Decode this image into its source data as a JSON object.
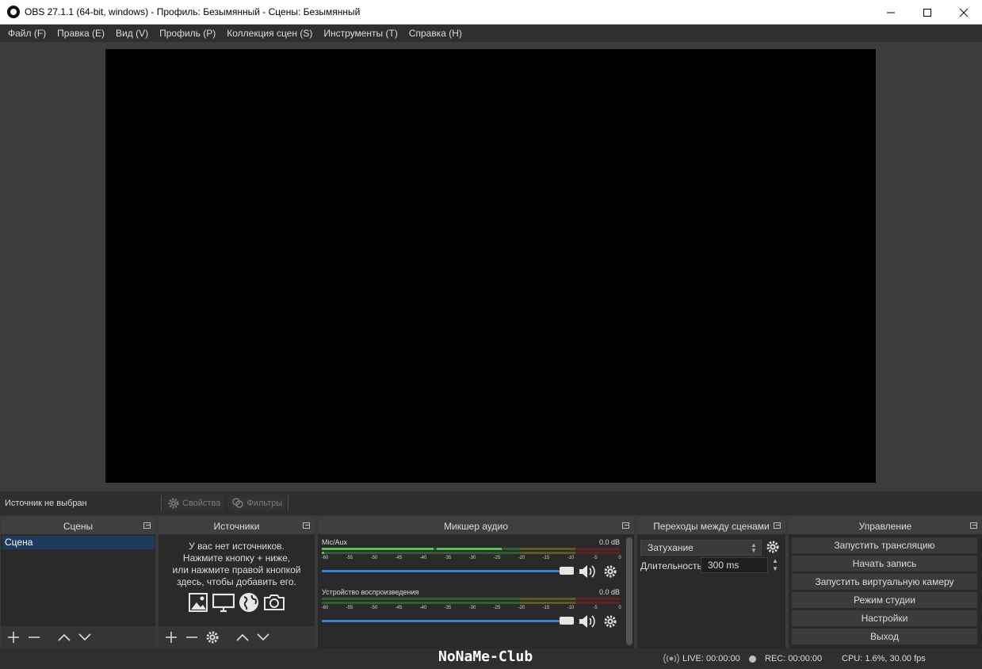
{
  "window": {
    "title": "OBS 27.1.1 (64-bit, windows) - Профиль: Безымянный - Сцены: Безымянный",
    "minimize": "—",
    "maximize": "☐",
    "close": "✕"
  },
  "menu": [
    "Файл (F)",
    "Правка (E)",
    "Вид (V)",
    "Профиль (P)",
    "Коллекция сцен (S)",
    "Инструменты (T)",
    "Справка (H)"
  ],
  "source_bar": {
    "no_source": "Источник не выбран",
    "properties": "Свойства",
    "filters": "Фильтры"
  },
  "docks": {
    "scenes": {
      "title": "Сцены",
      "items": [
        "Сцена"
      ]
    },
    "sources": {
      "title": "Источники",
      "empty_line1": "У вас нет источников.",
      "empty_line2": "Нажмите кнопку + ниже,",
      "empty_line3": "или нажмите правой кнопкой",
      "empty_line4": "здесь, чтобы добавить его."
    },
    "mixer": {
      "title": "Микшер аудио",
      "channels": [
        {
          "name": "Mic/Aux",
          "db": "0.0 dB",
          "volume": 1.0
        },
        {
          "name": "Устройство воспроизведения",
          "db": "0.0 dB",
          "volume": 1.0
        }
      ],
      "ticks": [
        "-60",
        "-55",
        "-50",
        "-45",
        "-40",
        "-35",
        "-30",
        "-25",
        "-20",
        "-15",
        "-10",
        "-5",
        "0"
      ]
    },
    "transitions": {
      "title": "Переходы между сценами",
      "selected": "Затухание",
      "duration_label": "Длительность",
      "duration_value": "300 ms"
    },
    "controls": {
      "title": "Управление",
      "buttons": [
        "Запустить трансляцию",
        "Начать запись",
        "Запустить виртуальную камеру",
        "Режим студии",
        "Настройки",
        "Выход"
      ]
    }
  },
  "status": {
    "watermark": "NoNaMe-Club",
    "live": "LIVE: 00:00:00",
    "rec": "REC: 00:00:00",
    "cpu": "CPU: 1.6%, 30.00 fps"
  },
  "colors": {
    "accent_blue": "#3b82d6",
    "meter_green": "#4caf50",
    "meter_yellow": "#a89b32",
    "meter_red": "#a33a3a",
    "selection": "#1e3b5c"
  }
}
